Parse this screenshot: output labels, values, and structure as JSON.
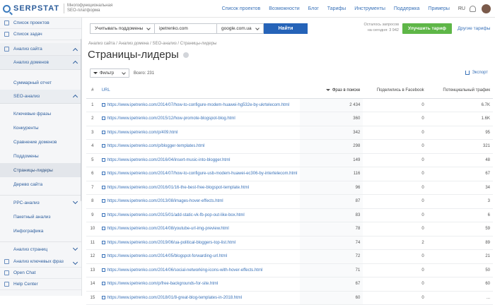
{
  "header": {
    "logo": "SERPSTAT",
    "tagline_1": "Многофункциональная",
    "tagline_2": "SEO-платформа",
    "nav": [
      "Список проектов",
      "Возможности",
      "Блог",
      "Тарифы",
      "Инструменты",
      "Поддержка",
      "Примеры"
    ],
    "lang": "RU"
  },
  "sidebar": {
    "top_items": [
      "Список проектов",
      "Список задач"
    ],
    "section_site": "Анализ сайта",
    "section_domains": "Анализ доменов",
    "summary": "Суммарный отчет",
    "section_seo": "SEO-анализ",
    "seo_items": [
      "Ключевые фразы",
      "Конкуренты",
      "Сравнение доменов",
      "Поддомены",
      "Страницы-лидеры",
      "Дерево сайта"
    ],
    "section_ppc": "PPC-анализ",
    "ppc_items": [
      "Пакетный анализ",
      "Инфографика"
    ],
    "section_pages": "Анализ страниц",
    "section_keywords": "Анализ ключевых фраз",
    "open_chat": "Open Chat",
    "help_center": "Help Center"
  },
  "search": {
    "mode": "Учитывать поддомены",
    "domain": "ipetrenko.com",
    "engine": "google.com.ua",
    "find": "Найти"
  },
  "requests": {
    "line1": "Осталось запросов",
    "line2": "на сегодня: 3 942"
  },
  "upgrade": "Улучшить тариф",
  "other_tariffs": "Другие тарифы",
  "breadcrumbs": "Анализ сайта / Анализ домена / SEO-анализ / Страницы-лидеры",
  "page_title": "Страницы-лидеры",
  "filter_label": "Фильтр",
  "total_label": "Всего: 231",
  "export_label": "Экспорт",
  "table": {
    "headers": {
      "num": "#",
      "url": "URL",
      "phrases": "Фраз в поиске",
      "facebook": "Поделились в Facebook",
      "traffic": "Потенциальный трафик"
    },
    "rows": [
      {
        "n": "1",
        "url": "https://www.ipetrenko.com/2014/07/how-to-configure-modem-huawei-hg532e-by-ukrtelecom.html",
        "phrases": "2 434",
        "fb": "0",
        "traffic": "6.7K"
      },
      {
        "n": "2",
        "url": "https://www.ipetrenko.com/2015/12/how-promote-blogspot-blog.html",
        "phrases": "360",
        "fb": "0",
        "traffic": "1.6K"
      },
      {
        "n": "3",
        "url": "https://www.ipetrenko.com/p/409.html",
        "phrases": "342",
        "fb": "0",
        "traffic": "95"
      },
      {
        "n": "4",
        "url": "https://www.ipetrenko.com/p/blogger-templates.html",
        "phrases": "298",
        "fb": "0",
        "traffic": "321"
      },
      {
        "n": "5",
        "url": "https://www.ipetrenko.com/2016/04/insert-music-into-blogger.html",
        "phrases": "149",
        "fb": "0",
        "traffic": "48"
      },
      {
        "n": "6",
        "url": "https://www.ipetrenko.com/2014/07/how-to-configure-usb-modem-huawei-ec306-by-intertelecom.html",
        "phrases": "116",
        "fb": "0",
        "traffic": "67"
      },
      {
        "n": "7",
        "url": "https://www.ipetrenko.com/2016/01/16-the-best-free-blogspot-template.html",
        "phrases": "96",
        "fb": "0",
        "traffic": "34"
      },
      {
        "n": "8",
        "url": "https://www.ipetrenko.com/2013/08/images-hover-effects.html",
        "phrases": "87",
        "fb": "0",
        "traffic": "3"
      },
      {
        "n": "9",
        "url": "https://www.ipetrenko.com/2015/01/add-static-vk-fb-pop-out-like-box.html",
        "phrases": "83",
        "fb": "0",
        "traffic": "6"
      },
      {
        "n": "10",
        "url": "https://www.ipetrenko.com/2014/08/youtube-url-img-preview.html",
        "phrases": "78",
        "fb": "0",
        "traffic": "59"
      },
      {
        "n": "11",
        "url": "https://www.ipetrenko.com/2019/06/ua-political-bloggers-top-list.html",
        "phrases": "74",
        "fb": "2",
        "traffic": "89"
      },
      {
        "n": "12",
        "url": "https://www.ipetrenko.com/2014/05/blogspot-forwarding-url.html",
        "phrases": "72",
        "fb": "0",
        "traffic": "21"
      },
      {
        "n": "13",
        "url": "https://www.ipetrenko.com/2014/06/social-networking-icons-with-hover-effects.html",
        "phrases": "71",
        "fb": "0",
        "traffic": "50"
      },
      {
        "n": "14",
        "url": "https://www.ipetrenko.com/p/free-backgrounds-for-site.html",
        "phrases": "67",
        "fb": "0",
        "traffic": "60"
      },
      {
        "n": "15",
        "url": "https://www.ipetrenko.com/2018/01/8-great-blog-templates-in-2018.html",
        "phrases": "60",
        "fb": "0",
        "traffic": "..."
      }
    ]
  }
}
